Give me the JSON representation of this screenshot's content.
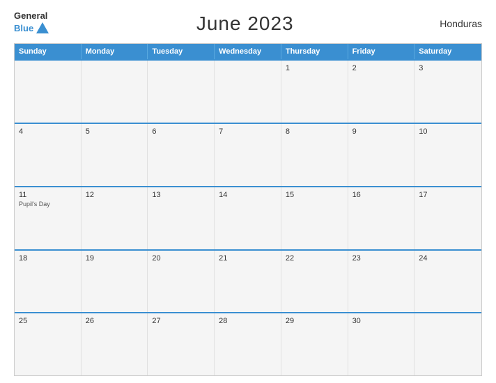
{
  "header": {
    "title": "June 2023",
    "country": "Honduras",
    "logo_general": "General",
    "logo_blue": "Blue"
  },
  "calendar": {
    "days_of_week": [
      "Sunday",
      "Monday",
      "Tuesday",
      "Wednesday",
      "Thursday",
      "Friday",
      "Saturday"
    ],
    "weeks": [
      [
        {
          "num": "",
          "empty": true
        },
        {
          "num": "",
          "empty": true
        },
        {
          "num": "",
          "empty": true
        },
        {
          "num": "",
          "empty": true
        },
        {
          "num": "1",
          "empty": false
        },
        {
          "num": "2",
          "empty": false
        },
        {
          "num": "3",
          "empty": false
        }
      ],
      [
        {
          "num": "4",
          "empty": false
        },
        {
          "num": "5",
          "empty": false
        },
        {
          "num": "6",
          "empty": false
        },
        {
          "num": "7",
          "empty": false
        },
        {
          "num": "8",
          "empty": false
        },
        {
          "num": "9",
          "empty": false
        },
        {
          "num": "10",
          "empty": false
        }
      ],
      [
        {
          "num": "11",
          "empty": false,
          "event": "Pupil's Day"
        },
        {
          "num": "12",
          "empty": false
        },
        {
          "num": "13",
          "empty": false
        },
        {
          "num": "14",
          "empty": false
        },
        {
          "num": "15",
          "empty": false
        },
        {
          "num": "16",
          "empty": false
        },
        {
          "num": "17",
          "empty": false
        }
      ],
      [
        {
          "num": "18",
          "empty": false
        },
        {
          "num": "19",
          "empty": false
        },
        {
          "num": "20",
          "empty": false
        },
        {
          "num": "21",
          "empty": false
        },
        {
          "num": "22",
          "empty": false
        },
        {
          "num": "23",
          "empty": false
        },
        {
          "num": "24",
          "empty": false
        }
      ],
      [
        {
          "num": "25",
          "empty": false
        },
        {
          "num": "26",
          "empty": false
        },
        {
          "num": "27",
          "empty": false
        },
        {
          "num": "28",
          "empty": false
        },
        {
          "num": "29",
          "empty": false
        },
        {
          "num": "30",
          "empty": false
        },
        {
          "num": "",
          "empty": true
        }
      ]
    ]
  }
}
